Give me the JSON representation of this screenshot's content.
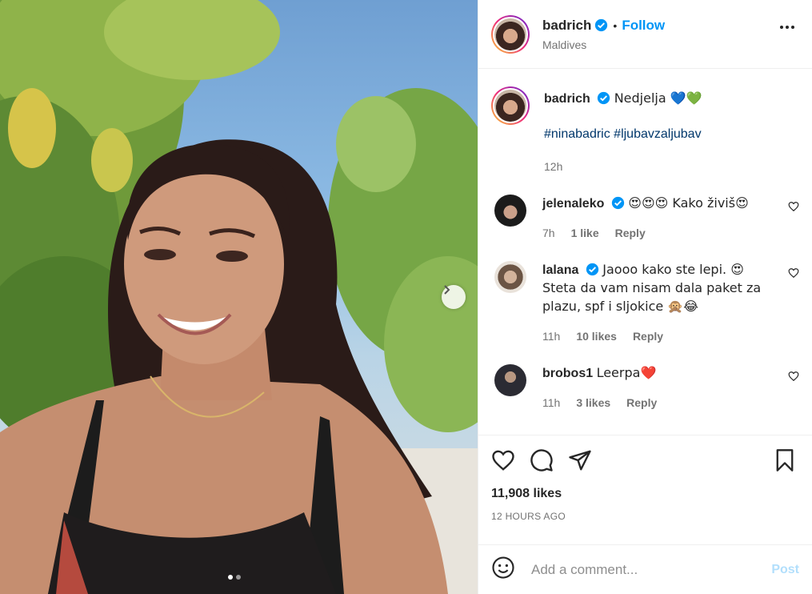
{
  "header": {
    "username": "badrich",
    "separator": "•",
    "follow_label": "Follow",
    "location": "Maldives"
  },
  "caption": {
    "username": "badrich",
    "text": "Nedjelja 💙💚",
    "hashtags": "#ninabadric #ljubavzaljubav",
    "time": "12h"
  },
  "comments": [
    {
      "username": "jelenaleko",
      "text": "😍😍😍 Kako živiš😍",
      "time": "7h",
      "likes": "1 like",
      "reply": "Reply",
      "avatar_color": "#2a2a2a"
    },
    {
      "username": "lalana",
      "text": "Jaooo kako ste lepi. 😍 Steta da vam nisam dala paket za plazu, spf i sljokice 🙊😂",
      "time": "11h",
      "likes": "10 likes",
      "reply": "Reply",
      "avatar_color": "#8a6f5a"
    },
    {
      "username": "brobos1",
      "text": "Leerpa❤️",
      "time": "11h",
      "likes": "3 likes",
      "reply": "Reply",
      "avatar_color": "#3c3c44"
    }
  ],
  "stats": {
    "likes": "11,908 likes",
    "posted_ago": "12 HOURS AGO"
  },
  "composer": {
    "placeholder": "Add a comment...",
    "post_label": "Post"
  },
  "carousel": {
    "current": 1,
    "total": 2
  },
  "colors": {
    "accent": "#0095f6",
    "verified": "#0095f6",
    "link": "#00376b"
  }
}
